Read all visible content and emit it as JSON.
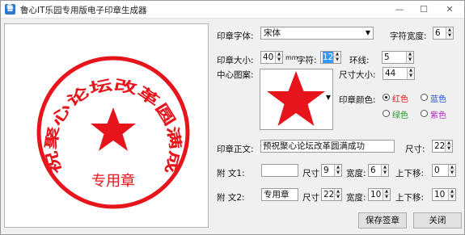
{
  "window": {
    "title": "鲁心IT乐园专用版电子印章生成器",
    "minimize": "—",
    "maximize": "☐",
    "close": "✕"
  },
  "stamp": {
    "color": "#e8141b",
    "main_text": "预祝聚心论坛改革圆满成功",
    "sub_text": "专用章",
    "center_icon": "star-icon"
  },
  "form": {
    "font_label": "印章字体:",
    "font_value": "宋体",
    "char_width_label": "字符宽度:",
    "char_width_value": "6",
    "size_label": "印章大小:",
    "size_value": "40",
    "size_unit": "mm",
    "char_label": "字符:",
    "char_value": "12",
    "ring_label": "环线:",
    "ring_value": "5",
    "center_label": "中心图案:",
    "dim_label": "尺寸大小:",
    "dim_value": "44",
    "color_label": "印章颜色:",
    "colors": {
      "red": "红色",
      "blue": "蓝色",
      "green": "绿色",
      "purple": "紫色"
    },
    "color_hex": {
      "red": "#e8141b",
      "blue": "#2255d4",
      "green": "#1f9a2a",
      "purple": "#b12bbd"
    },
    "main_label": "印章正文:",
    "main_value": "预祝聚心论坛改革圆满成功",
    "main_size_label": "尺寸:",
    "main_size_value": "22",
    "sub1_label": "附    文1:",
    "sub1_value": "",
    "sub1_size_label": "尺寸",
    "sub1_size_value": "9",
    "sub1_width_label": "宽度:",
    "sub1_width_value": "6",
    "sub1_shift_label": "上下移:",
    "sub1_shift_value": "0",
    "sub2_label": "附    文2:",
    "sub2_value": "专用章",
    "sub2_size_label": "尺寸",
    "sub2_size_value": "22",
    "sub2_width_label": "宽度:",
    "sub2_width_value": "10",
    "sub2_shift_label": "上下移:",
    "sub2_shift_value": "10"
  },
  "buttons": {
    "save": "保存签章",
    "close": "关闭"
  }
}
